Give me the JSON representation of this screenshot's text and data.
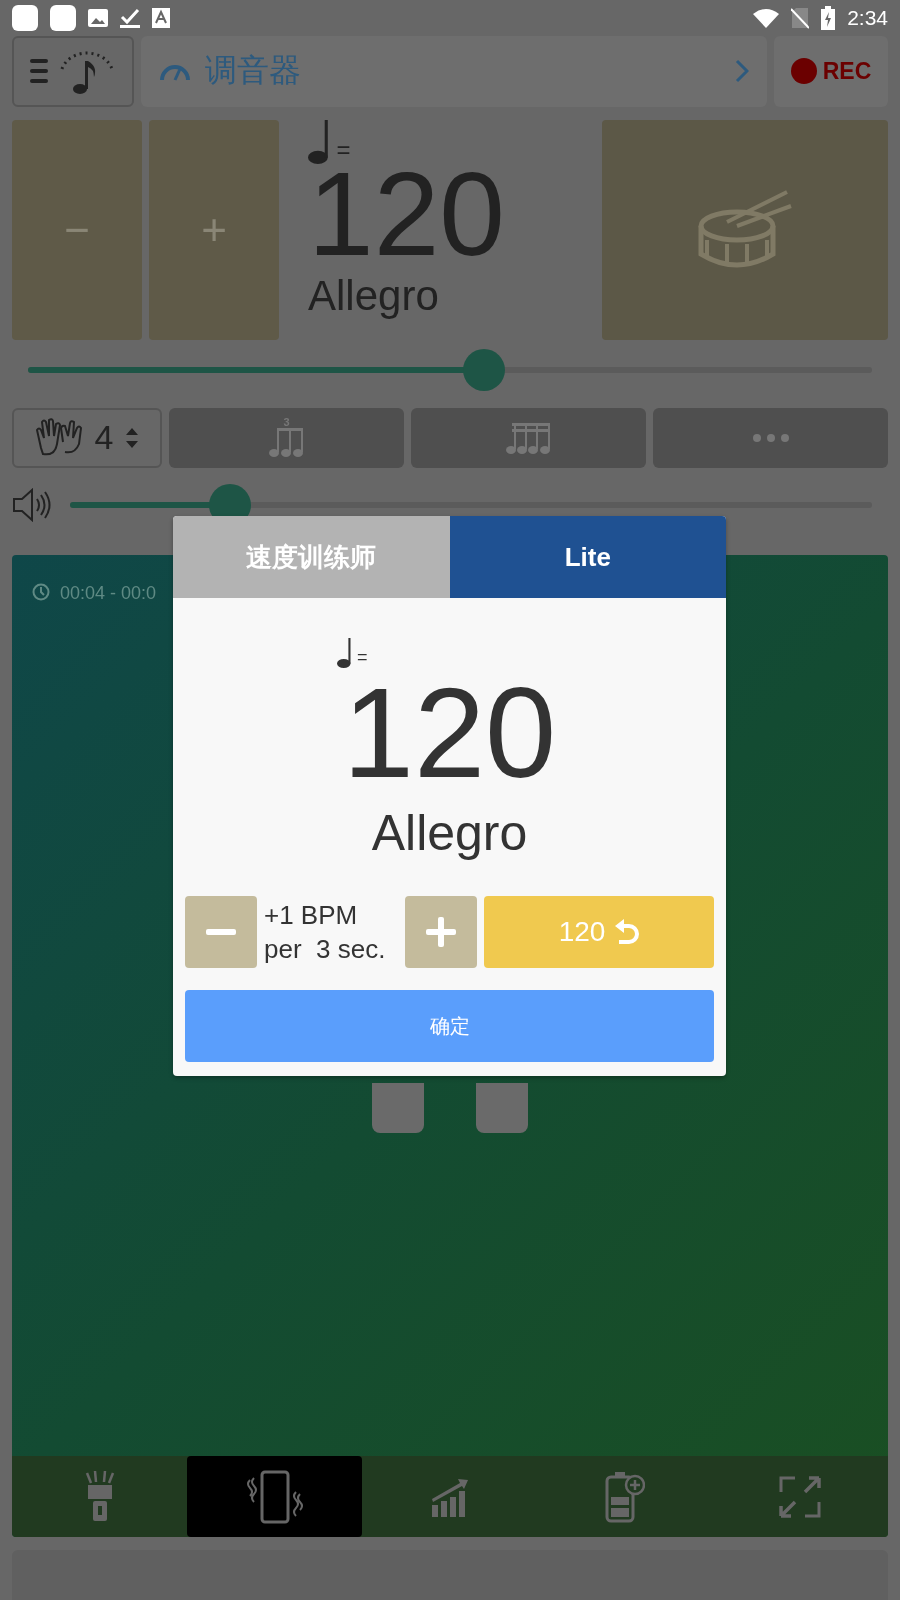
{
  "status_bar": {
    "time": "2:34"
  },
  "top_bar": {
    "title": "调音器",
    "rec": "REC"
  },
  "tempo": {
    "minus": "−",
    "plus": "+",
    "equals": "=",
    "bpm": "120",
    "marking": "Allegro"
  },
  "tempo_slider": {
    "level": 0.54
  },
  "beats": {
    "value": "4"
  },
  "triplet_mark": "3",
  "volume": {
    "level": 0.2
  },
  "timer": {
    "text": "00:04 - 00:0"
  },
  "toolbar": {
    "items": [
      {
        "kind": "flashlight",
        "selected": false
      },
      {
        "kind": "vibrate",
        "selected": true
      },
      {
        "kind": "chart",
        "selected": false
      },
      {
        "kind": "battery",
        "selected": false
      },
      {
        "kind": "fullscreen",
        "selected": false
      }
    ]
  },
  "dialog": {
    "tabs": [
      {
        "label": "速度训练师",
        "selected": false
      },
      {
        "label": "Lite",
        "selected": true
      }
    ],
    "equals": "=",
    "bpm": "120",
    "marking": "Allegro",
    "step": "+1 BPM",
    "interval": "per  3 sec.",
    "reset": "120",
    "ok": "确定"
  }
}
